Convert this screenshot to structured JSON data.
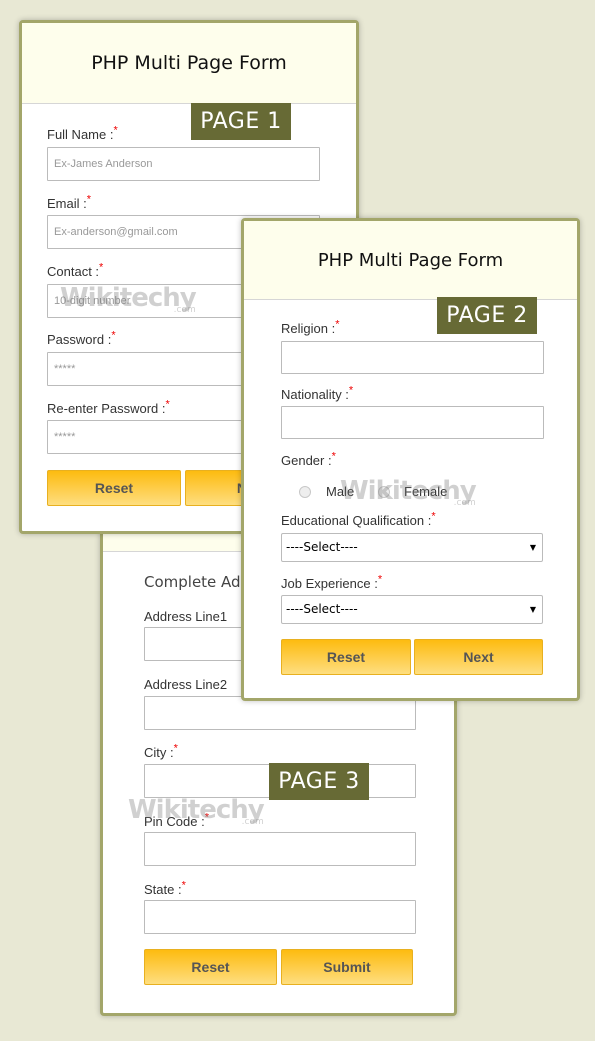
{
  "colors": {
    "background": "#e8e8d4",
    "card_border": "#a3a66a",
    "header_bg": "#fefeec",
    "badge_bg": "#676a35",
    "button_top": "#fdbb10",
    "button_bottom": "#fede80",
    "required": "#e00000"
  },
  "watermark": {
    "text": "Wikitechy",
    "suffix": ".com"
  },
  "page1": {
    "title": "PHP Multi Page Form",
    "badge": "PAGE 1",
    "required_mark": "*",
    "fields": [
      {
        "label": "Full Name :",
        "placeholder": "Ex-James Anderson"
      },
      {
        "label": "Email :",
        "placeholder": "Ex-anderson@gmail.com"
      },
      {
        "label": "Contact :",
        "placeholder": "10-digit number"
      },
      {
        "label": "Password :",
        "placeholder": "*****"
      },
      {
        "label": "Re-enter Password :",
        "placeholder": "*****"
      }
    ],
    "buttons": {
      "reset": "Reset",
      "next": "Next"
    }
  },
  "page2": {
    "title": "PHP Multi Page Form",
    "badge": "PAGE 2",
    "required_mark": "*",
    "religion_label": "Religion :",
    "nationality_label": "Nationality :",
    "gender_label": "Gender :",
    "gender_options": [
      "Male",
      "Female"
    ],
    "education_label": "Educational Qualification :",
    "education_value": "----Select----",
    "experience_label": "Job Experience :",
    "experience_value": "----Select----",
    "buttons": {
      "reset": "Reset",
      "next": "Next"
    }
  },
  "page3": {
    "heading": "Complete Address",
    "badge": "PAGE 3",
    "required_mark": "*",
    "fields": [
      {
        "label": "Address Line1",
        "required": false
      },
      {
        "label": "Address Line2",
        "required": false
      },
      {
        "label": "City :",
        "required": true
      },
      {
        "label": "Pin Code :",
        "required": true
      },
      {
        "label": "State :",
        "required": true
      }
    ],
    "buttons": {
      "reset": "Reset",
      "submit": "Submit"
    }
  }
}
